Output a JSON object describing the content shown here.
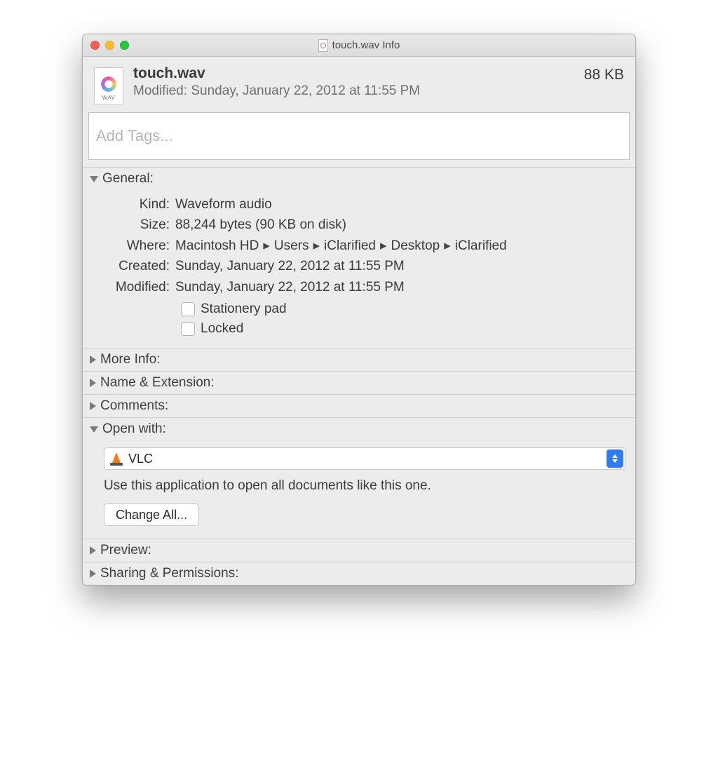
{
  "window": {
    "title": "touch.wav Info"
  },
  "header": {
    "filename": "touch.wav",
    "file_ext_badge": "WAV",
    "modified_line": "Modified: Sunday, January 22, 2012 at 11:55 PM",
    "size": "88 KB"
  },
  "tags": {
    "placeholder": "Add Tags..."
  },
  "sections": {
    "general": {
      "title": "General:",
      "kind_label": "Kind:",
      "kind_value": "Waveform audio",
      "size_label": "Size:",
      "size_value": "88,244 bytes (90 KB on disk)",
      "where_label": "Where:",
      "where_parts": [
        "Macintosh HD",
        "Users",
        "iClarified",
        "Desktop",
        "iClarified"
      ],
      "created_label": "Created:",
      "created_value": "Sunday, January 22, 2012 at 11:55 PM",
      "modified_label": "Modified:",
      "modified_value": "Sunday, January 22, 2012 at 11:55 PM",
      "stationery_label": "Stationery pad",
      "locked_label": "Locked"
    },
    "more_info": {
      "title": "More Info:"
    },
    "name_ext": {
      "title": "Name & Extension:"
    },
    "comments": {
      "title": "Comments:"
    },
    "open_with": {
      "title": "Open with:",
      "app": "VLC",
      "hint": "Use this application to open all documents like this one.",
      "change_all": "Change All..."
    },
    "preview": {
      "title": "Preview:"
    },
    "sharing": {
      "title": "Sharing & Permissions:"
    }
  }
}
